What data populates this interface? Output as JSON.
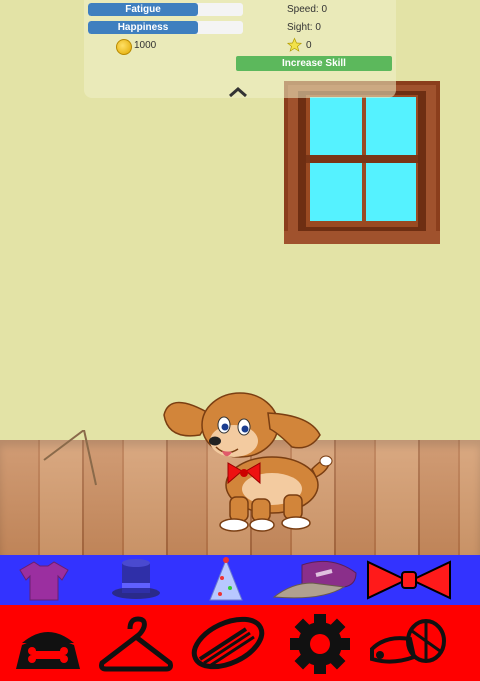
{
  "hud": {
    "fatigue": {
      "label": "Fatigue",
      "level": 0.71
    },
    "happiness": {
      "label": "Happiness",
      "level": 0.71
    },
    "speed": "Speed: 0",
    "sight": "Sight: 0",
    "coins": "1000",
    "stars": "0",
    "increase_skill": "Increase Skill"
  },
  "colors": {
    "wall": "#e3e3a6",
    "bar_fill": "#3f7fbf",
    "skill_button": "#5cb85c",
    "wardrobe_bar": "#3333ff",
    "menu_bar": "#ff0000"
  },
  "wardrobe": [
    {
      "icon": "tshirt-icon"
    },
    {
      "icon": "top-hat-icon"
    },
    {
      "icon": "party-hat-icon"
    },
    {
      "icon": "cap-icon"
    },
    {
      "icon": "bowtie-icon"
    }
  ],
  "menu": [
    {
      "icon": "food-bowl-icon"
    },
    {
      "icon": "hanger-icon"
    },
    {
      "icon": "brush-icon"
    },
    {
      "icon": "gear-icon"
    },
    {
      "icon": "toy-icon"
    }
  ]
}
